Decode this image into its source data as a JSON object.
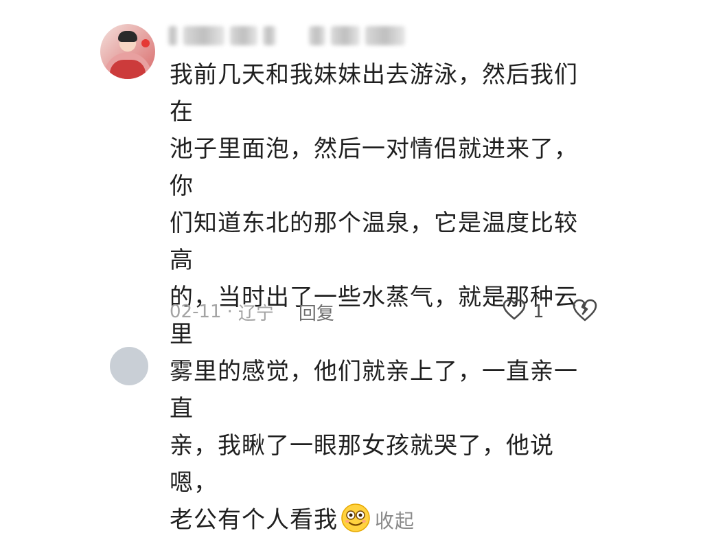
{
  "comment": {
    "lines": [
      "我前几天和我妹妹出去游泳，然后我们在",
      "池子里面泡，然后一对情侣就进来了，你",
      "们知道东北的那个温泉，它是温度比较高",
      "的，当时出了一些水蒸气，就是那种云里",
      "雾里的感觉，他们就亲上了，一直亲一直",
      "亲，我瞅了一眼那女孩就哭了，他说嗯，",
      "老公有个人看我"
    ],
    "collapse_label": "收起"
  },
  "meta": {
    "date": "02-11",
    "separator": "·",
    "location": "辽宁",
    "reply_label": "回复"
  },
  "like": {
    "count": "1",
    "icon": "heart-outline-icon"
  },
  "dislike": {
    "icon": "broken-heart-icon"
  },
  "colors": {
    "text": "#1f1f1f",
    "meta": "#a3a3a3",
    "collapse": "#8a8a8a"
  }
}
